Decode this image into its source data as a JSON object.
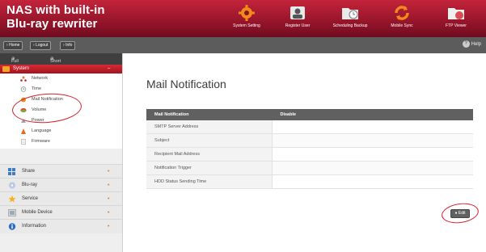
{
  "header": {
    "brand_line1": "NAS with built-in",
    "brand_line2": "Blu-ray rewriter",
    "nav": [
      {
        "label": "System Setting",
        "icon": "gear-icon"
      },
      {
        "label": "Register User",
        "icon": "user-icon"
      },
      {
        "label": "Scheduling Backup",
        "icon": "folder-clock-icon"
      },
      {
        "label": "Mobile Sync",
        "icon": "sync-icon"
      },
      {
        "label": "FTP Viewer",
        "icon": "folder-globe-icon"
      }
    ]
  },
  "toolbar": {
    "home_label": "Home",
    "logout_label": "Logout",
    "info_label": "Info",
    "help_label": "Help"
  },
  "sidebar": {
    "full_menu_label": "Full Menu",
    "short_menu_label": "Short Menu",
    "section_system": "System",
    "system_items": [
      "Network",
      "Time",
      "Mail Notification",
      "Volume",
      "Power",
      "Language",
      "Firmware"
    ],
    "main_items": [
      "Share",
      "Blu-ray",
      "Service",
      "Mobile Device",
      "Information"
    ]
  },
  "main": {
    "title": "Mail Notification",
    "table_header": {
      "key": "Mail Notification",
      "value": "Disable"
    },
    "rows": [
      {
        "label": "SMTP Server Address",
        "value": ""
      },
      {
        "label": "Subject",
        "value": ""
      },
      {
        "label": "Recipient Mail Address",
        "value": ""
      },
      {
        "label": "Notification Trigger",
        "value": ""
      },
      {
        "label": "HDD Status Sending Time",
        "value": ""
      }
    ],
    "edit_label": "Edit"
  },
  "colors": {
    "brand": "#9c1a2e",
    "toolbar": "#5c5c5c",
    "section_active": "#c0202c",
    "annotation": "#d4202a"
  }
}
